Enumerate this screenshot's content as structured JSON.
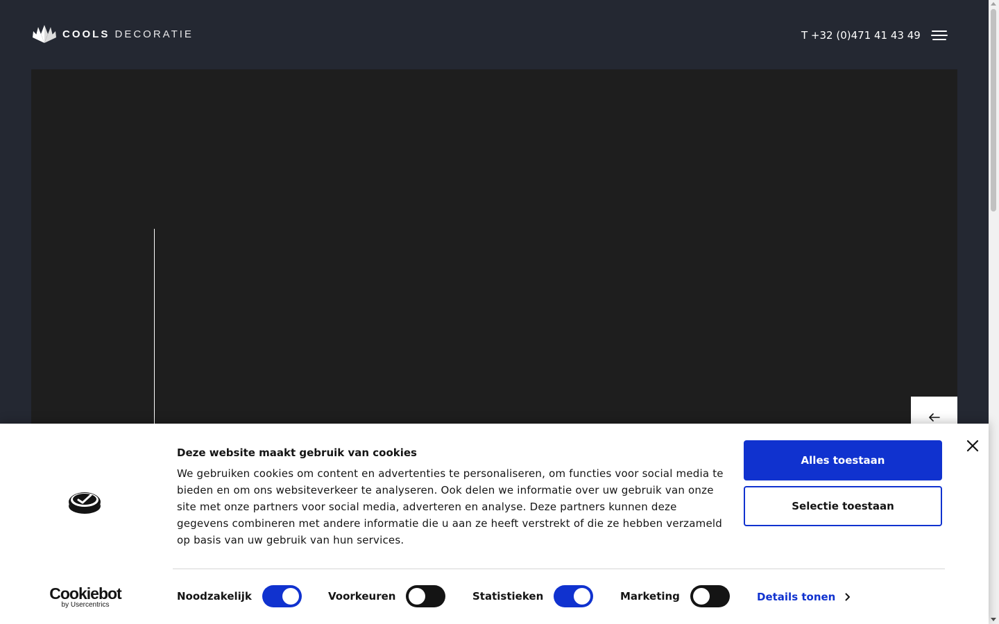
{
  "header": {
    "logo_word1": "COOLS",
    "logo_word2": "DECORATIE",
    "phone": "T +32 (0)471 41 43 49",
    "menu_icon": "hamburger-icon"
  },
  "hero": {
    "prev_icon": "arrow-left-icon"
  },
  "cookie_banner": {
    "title": "Deze website maakt gebruik van cookies",
    "text": "We gebruiken cookies om content en advertenties te personaliseren, om functies voor social media te bieden en om ons websiteverkeer te analyseren. Ook delen we informatie over uw gebruik van onze site met onze partners voor social media, adverteren en analyse. Deze partners kunnen deze gegevens combineren met andere informatie die u aan ze heeft verstrekt of die ze hebben verzameld op basis van uw gebruik van hun services.",
    "allow_all": "Alles toestaan",
    "allow_selection": "Selectie toestaan",
    "details": "Details tonen",
    "brand_name": "Cookiebot",
    "brand_sub": "by Usercentrics",
    "toggles": [
      {
        "label": "Noodzakelijk",
        "on": true
      },
      {
        "label": "Voorkeuren",
        "on": false
      },
      {
        "label": "Statistieken",
        "on": true
      },
      {
        "label": "Marketing",
        "on": false
      }
    ]
  },
  "colors": {
    "page_bg": "#242832",
    "hero_bg": "#1e1e1e",
    "accent": "#1032cf",
    "toggle_off": "#141414",
    "text": "#141414"
  }
}
